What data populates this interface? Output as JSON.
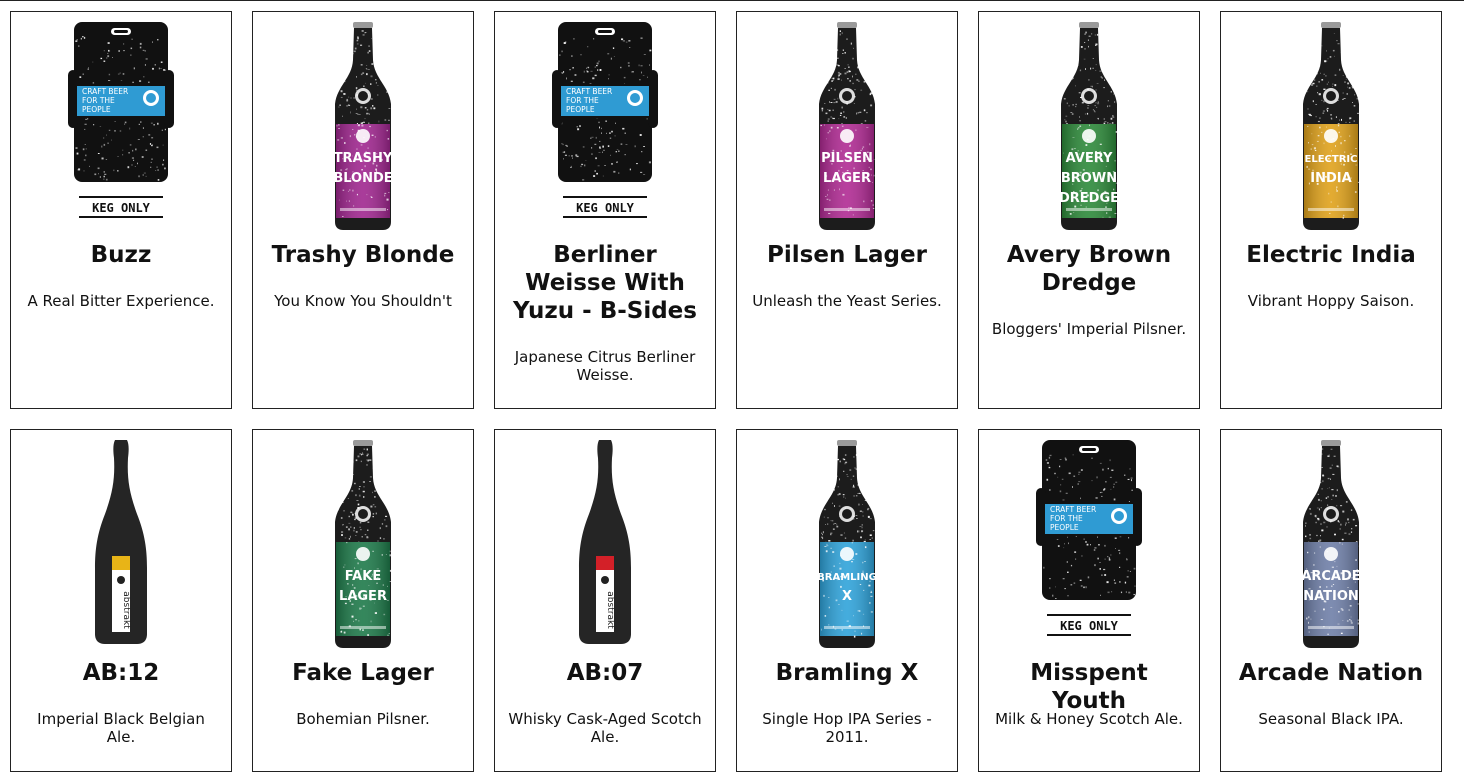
{
  "colors": {
    "border": "#222222",
    "text": "#111111",
    "bottle": "#1c1c1c",
    "keg_label": "#2f9bd3"
  },
  "beers": [
    {
      "name": "Buzz",
      "tagline": "A Real Bitter Experience.",
      "image": "keg-icon",
      "keg_label": "KEG ONLY",
      "keg_text": [
        "CRAFT BEER",
        "FOR THE",
        "PEOPLE"
      ],
      "label_color": "#2f9bd3"
    },
    {
      "name": "Trashy Blonde",
      "tagline": "You Know You Shouldn't",
      "image": "bottle-icon",
      "label_color": "#a0268f",
      "label_text": "TRASHY BLONDE"
    },
    {
      "name": "Berliner Weisse With Yuzu - B-Sides",
      "tagline": "Japanese Citrus Berliner Weisse.",
      "image": "keg-icon",
      "keg_label": "KEG ONLY",
      "keg_text": [
        "CRAFT BEER",
        "FOR THE",
        "PEOPLE"
      ],
      "label_color": "#2f9bd3"
    },
    {
      "name": "Pilsen Lager",
      "tagline": "Unleash the Yeast Series.",
      "image": "bottle-icon",
      "label_color": "#b02a93",
      "label_text": "PILSEN LAGER"
    },
    {
      "name": "Avery Brown Dredge",
      "tagline": "Bloggers' Imperial Pilsner.",
      "image": "bottle-icon",
      "label_color": "#2d8a3a",
      "label_text": "AVERY BROWN DREDGE"
    },
    {
      "name": "Electric India",
      "tagline": "Vibrant Hoppy Saison.",
      "image": "bottle-icon",
      "label_color": "#e0a21b",
      "label_text": "ELECTRIC INDIA"
    },
    {
      "name": "AB:12",
      "tagline": "Imperial Black Belgian Ale.",
      "image": "champagne-bottle-icon",
      "label_color": "#e8b417",
      "label_text": "abstrakt"
    },
    {
      "name": "Fake Lager",
      "tagline": "Bohemian Pilsner.",
      "image": "bottle-icon",
      "label_color": "#1e7a4a",
      "label_text": "FAKE LAGER"
    },
    {
      "name": "AB:07",
      "tagline": "Whisky Cask-Aged Scotch Ale.",
      "image": "champagne-bottle-icon",
      "label_color": "#d32028",
      "label_text": "abstrakt"
    },
    {
      "name": "Bramling X",
      "tagline": "Single Hop IPA Series - 2011.",
      "image": "bottle-icon",
      "label_color": "#2fa3da",
      "label_text": "BRAMLING X"
    },
    {
      "name": "Misspent Youth",
      "tagline": "Milk & Honey Scotch Ale.",
      "image": "keg-icon",
      "keg_label": "KEG ONLY",
      "keg_text": [
        "CRAFT BEER",
        "FOR THE",
        "PEOPLE"
      ],
      "label_color": "#2f9bd3"
    },
    {
      "name": "Arcade Nation",
      "tagline": "Seasonal Black IPA.",
      "image": "bottle-icon",
      "label_color": "#6f7fa8",
      "label_text": "ARCADE NATION"
    }
  ]
}
